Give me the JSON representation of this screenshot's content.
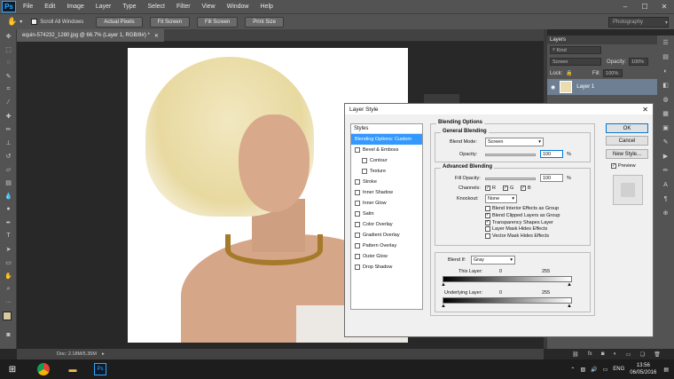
{
  "menubar": {
    "logo": "Ps",
    "items": [
      "File",
      "Edit",
      "Image",
      "Layer",
      "Type",
      "Select",
      "Filter",
      "View",
      "Window",
      "Help"
    ]
  },
  "options": {
    "scroll_all_label": "Scroll All Windows",
    "buttons": [
      "Actual Pixels",
      "Fit Screen",
      "Fill Screen",
      "Print Size"
    ],
    "workspace": "Photography"
  },
  "document": {
    "tab_title": "equin-574232_1280.jpg @ 66.7% (Layer 1, RGB/8#) *",
    "status": "Doc: 2.18M/5.35M"
  },
  "layers_panel": {
    "title": "Layers",
    "filter_kind": "Kind",
    "blend_mode": "Screen",
    "opacity_label": "Opacity:",
    "opacity_value": "100%",
    "lock_label": "Lock:",
    "fill_label": "Fill:",
    "fill_value": "100%",
    "layer_name": "Layer 1"
  },
  "dialog": {
    "title": "Layer Style",
    "styles_header": "Styles",
    "style_items": [
      {
        "label": "Blending Options: Custom",
        "selected": true,
        "checkbox": false,
        "indent": false
      },
      {
        "label": "Bevel & Emboss",
        "selected": false,
        "checkbox": true,
        "indent": false
      },
      {
        "label": "Contour",
        "selected": false,
        "checkbox": true,
        "indent": true
      },
      {
        "label": "Texture",
        "selected": false,
        "checkbox": true,
        "indent": true
      },
      {
        "label": "Stroke",
        "selected": false,
        "checkbox": true,
        "indent": false
      },
      {
        "label": "Inner Shadow",
        "selected": false,
        "checkbox": true,
        "indent": false
      },
      {
        "label": "Inner Glow",
        "selected": false,
        "checkbox": true,
        "indent": false
      },
      {
        "label": "Satin",
        "selected": false,
        "checkbox": true,
        "indent": false
      },
      {
        "label": "Color Overlay",
        "selected": false,
        "checkbox": true,
        "indent": false
      },
      {
        "label": "Gradient Overlay",
        "selected": false,
        "checkbox": true,
        "indent": false
      },
      {
        "label": "Pattern Overlay",
        "selected": false,
        "checkbox": true,
        "indent": false
      },
      {
        "label": "Outer Glow",
        "selected": false,
        "checkbox": true,
        "indent": false
      },
      {
        "label": "Drop Shadow",
        "selected": false,
        "checkbox": true,
        "indent": false
      }
    ],
    "blending_options_title": "Blending Options",
    "general_blending_title": "General Blending",
    "blend_mode_label": "Blend Mode:",
    "blend_mode_value": "Screen",
    "opacity_label": "Opacity:",
    "opacity_value": "100",
    "percent": "%",
    "advanced_blending_title": "Advanced Blending",
    "fill_opacity_label": "Fill Opacity:",
    "fill_opacity_value": "100",
    "channels_label": "Channels:",
    "channels": [
      "R",
      "G",
      "B"
    ],
    "knockout_label": "Knockout:",
    "knockout_value": "None",
    "adv_checks": [
      {
        "label": "Blend Interior Effects as Group",
        "checked": false
      },
      {
        "label": "Blend Clipped Layers as Group",
        "checked": true
      },
      {
        "label": "Transparency Shapes Layer",
        "checked": true
      },
      {
        "label": "Layer Mask Hides Effects",
        "checked": false
      },
      {
        "label": "Vector Mask Hides Effects",
        "checked": false
      }
    ],
    "blend_if_label": "Blend If:",
    "blend_if_value": "Gray",
    "this_layer_label": "This Layer:",
    "underlying_layer_label": "Underlying Layer:",
    "range_min": "0",
    "range_max": "255",
    "ok_label": "OK",
    "cancel_label": "Cancel",
    "new_style_label": "New Style...",
    "preview_label": "Preview",
    "check_mark": "✓"
  },
  "taskbar": {
    "language": "ENG",
    "time": "13:56",
    "date": "06/05/2016"
  }
}
